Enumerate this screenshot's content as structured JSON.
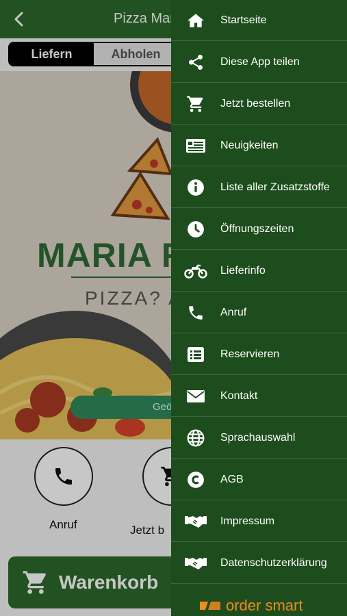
{
  "header": {
    "title": "Pizza Mar"
  },
  "order_mode": {
    "deliver_label": "Liefern",
    "pickup_label": "Abholen"
  },
  "hero": {
    "brand_name": "MARIA R",
    "tagline": "PIZZA? A",
    "locate_label": "Geö"
  },
  "actions": [
    {
      "label": "Anruf",
      "icon": "phone-icon"
    },
    {
      "label": "Jetzt b",
      "icon": "cart-icon"
    }
  ],
  "cart": {
    "label": "Warenkorb"
  },
  "drawer": {
    "items": [
      {
        "label": "Startseite",
        "icon": "home-icon"
      },
      {
        "label": "Diese App teilen",
        "icon": "share-icon"
      },
      {
        "label": "Jetzt bestellen",
        "icon": "cart-icon"
      },
      {
        "label": "Neuigkeiten",
        "icon": "news-icon"
      },
      {
        "label": "Liste aller Zusatzstoffe",
        "icon": "info-icon"
      },
      {
        "label": "Öffnungszeiten",
        "icon": "clock-icon"
      },
      {
        "label": "Lieferinfo",
        "icon": "motorcycle-icon"
      },
      {
        "label": "Anruf",
        "icon": "phone-icon"
      },
      {
        "label": "Reservieren",
        "icon": "list-icon"
      },
      {
        "label": "Kontakt",
        "icon": "envelope-icon"
      },
      {
        "label": "Sprachauswahl",
        "icon": "globe-icon"
      },
      {
        "label": "AGB",
        "icon": "copyright-icon"
      },
      {
        "label": "Impressum",
        "icon": "handshake-icon"
      },
      {
        "label": "Datenschutzerklärung",
        "icon": "handshake-icon"
      }
    ],
    "footer_brand": "order smart"
  },
  "colors": {
    "primary_green": "#2d6a2c",
    "drawer_green": "#1e4d1d",
    "brand_orange": "#f08a1e"
  }
}
